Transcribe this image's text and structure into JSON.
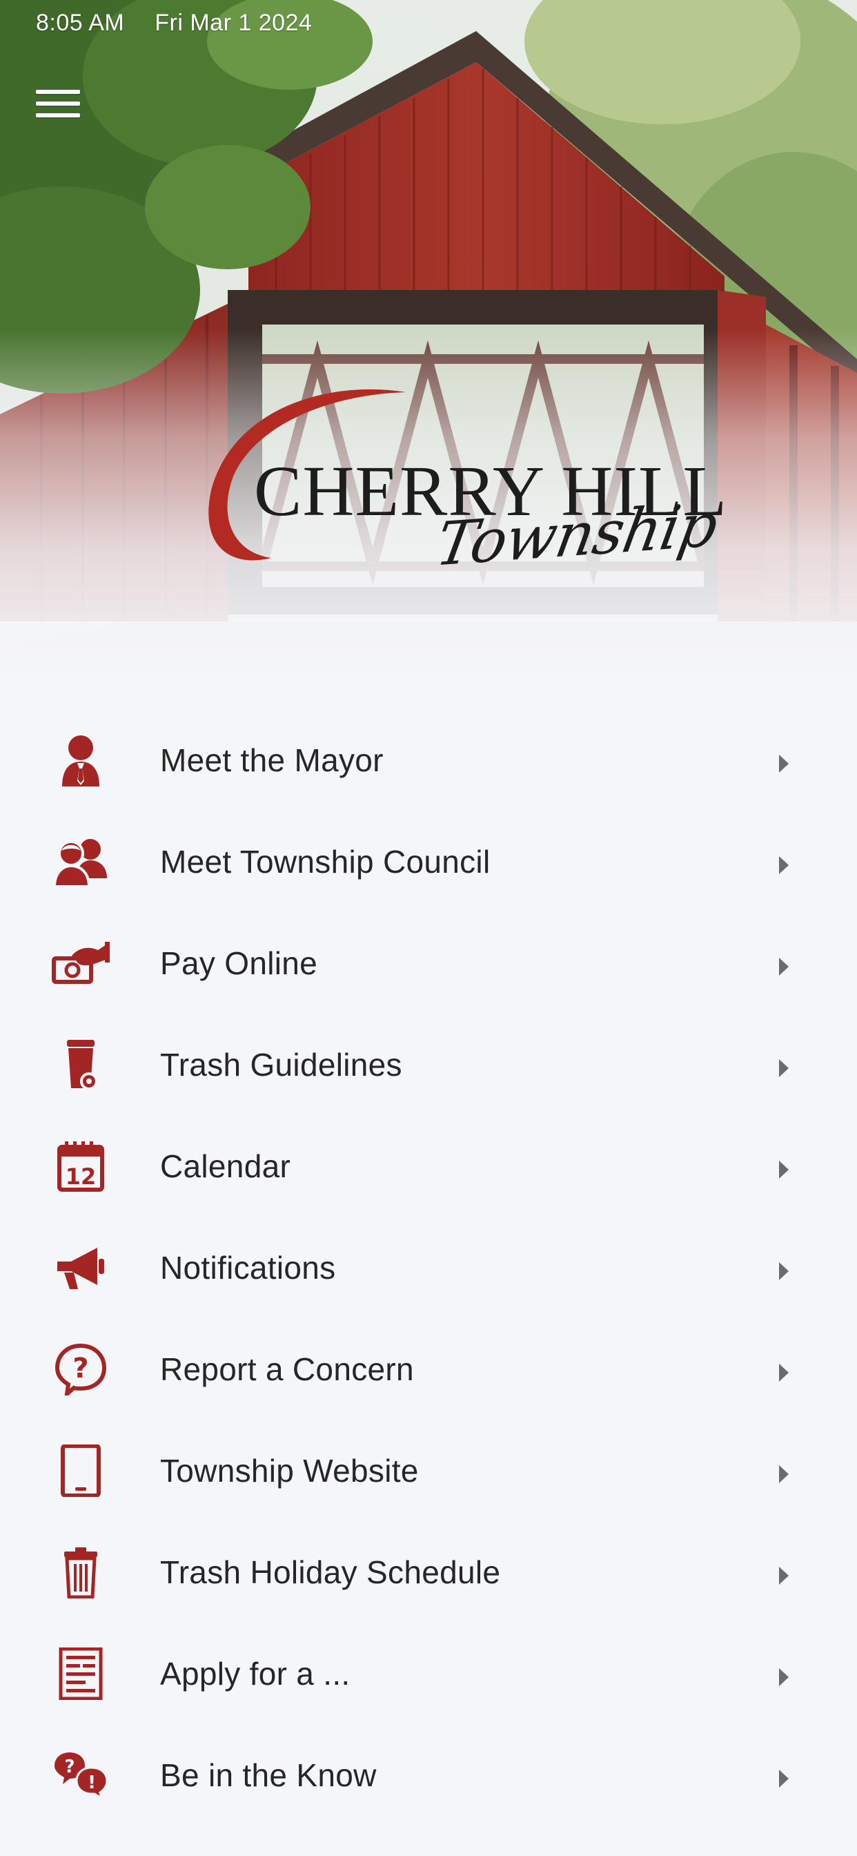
{
  "status_bar": {
    "time": "8:05 AM",
    "date": "Fri Mar 1  2024"
  },
  "header": {
    "menu_icon": "hamburger-menu-icon",
    "logo": {
      "wordmark": "CHERRY HILL",
      "script": "Township"
    }
  },
  "colors": {
    "accent": "#a32624",
    "text": "#262626",
    "background": "#f5f6f9",
    "chevron": "#6b6b6b"
  },
  "menu": {
    "items": [
      {
        "label": "Meet the Mayor",
        "icon": "mayor-person-icon"
      },
      {
        "label": "Meet Township Council",
        "icon": "council-people-icon"
      },
      {
        "label": "Pay Online",
        "icon": "hand-money-icon"
      },
      {
        "label": "Trash Guidelines",
        "icon": "trash-bin-icon"
      },
      {
        "label": "Calendar",
        "icon": "calendar-icon"
      },
      {
        "label": "Notifications",
        "icon": "megaphone-icon"
      },
      {
        "label": "Report a Concern",
        "icon": "question-bubble-icon"
      },
      {
        "label": "Township Website",
        "icon": "tablet-icon"
      },
      {
        "label": "Trash Holiday Schedule",
        "icon": "trash-can-icon"
      },
      {
        "label": "Apply for a ...",
        "icon": "form-document-icon"
      },
      {
        "label": "Be in the Know",
        "icon": "info-chat-icon"
      }
    ],
    "calendar_icon_day": "12"
  }
}
